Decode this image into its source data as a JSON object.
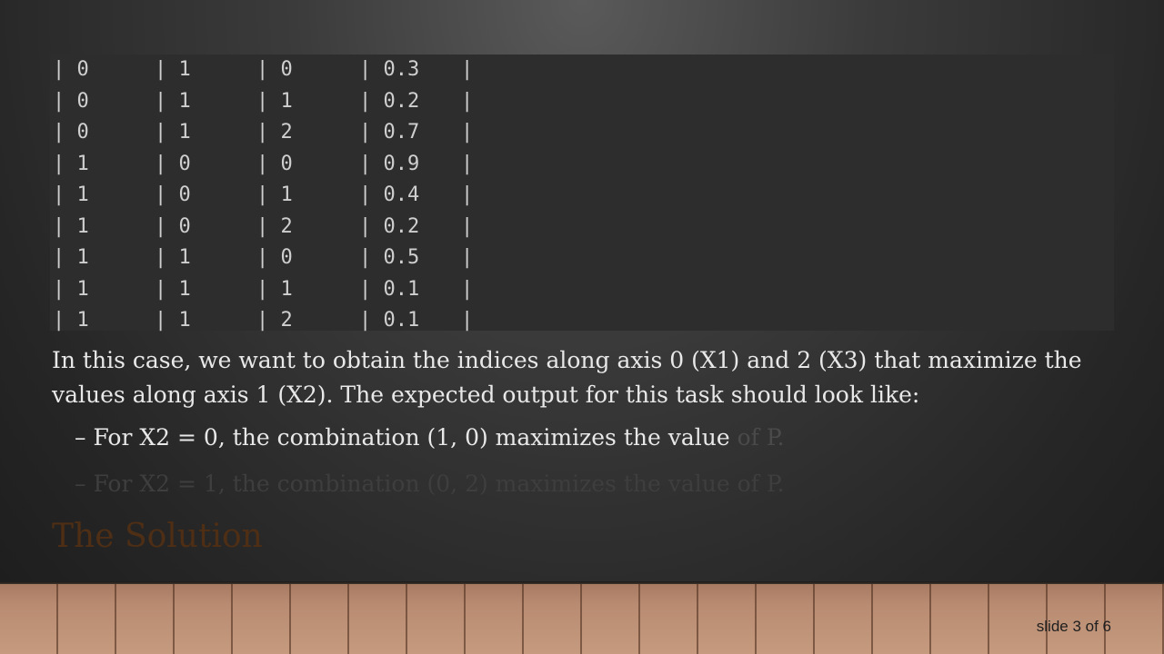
{
  "table": {
    "rows": [
      [
        "| 0",
        "| 1",
        "| 0",
        "| 0.3",
        "|"
      ],
      [
        "| 0",
        "| 1",
        "| 1",
        "| 0.2",
        "|"
      ],
      [
        "| 0",
        "| 1",
        "| 2",
        "| 0.7",
        "|"
      ],
      [
        "| 1",
        "| 0",
        "| 0",
        "| 0.9",
        "|"
      ],
      [
        "| 1",
        "| 0",
        "| 1",
        "| 0.4",
        "|"
      ],
      [
        "| 1",
        "| 0",
        "| 2",
        "| 0.2",
        "|"
      ],
      [
        "| 1",
        "| 1",
        "| 0",
        "| 0.5",
        "|"
      ],
      [
        "| 1",
        "| 1",
        "| 1",
        "| 0.1",
        "|"
      ],
      [
        "| 1",
        "| 1",
        "| 2",
        "| 0.1",
        "|"
      ]
    ]
  },
  "description": "In this case, we want to obtain the indices along axis 0 (X1) and 2 (X3) that maximize the values along axis 1 (X2). The expected output for this task should look like:",
  "bullets": [
    {
      "text": "– For X2 = 0, the combination (1, 0) maximizes the value",
      "faded_text": " of P."
    },
    {
      "text": "– For X2 = 1, the combination (0, 2) maximizes the value of P.",
      "faded_text": ""
    }
  ],
  "section_title": "The Solution",
  "slide_counter": "slide 3 of 6",
  "colors": {
    "code_background": "#2d2d2d",
    "section_title": "#4e2e14",
    "floor": "#b98c72"
  }
}
